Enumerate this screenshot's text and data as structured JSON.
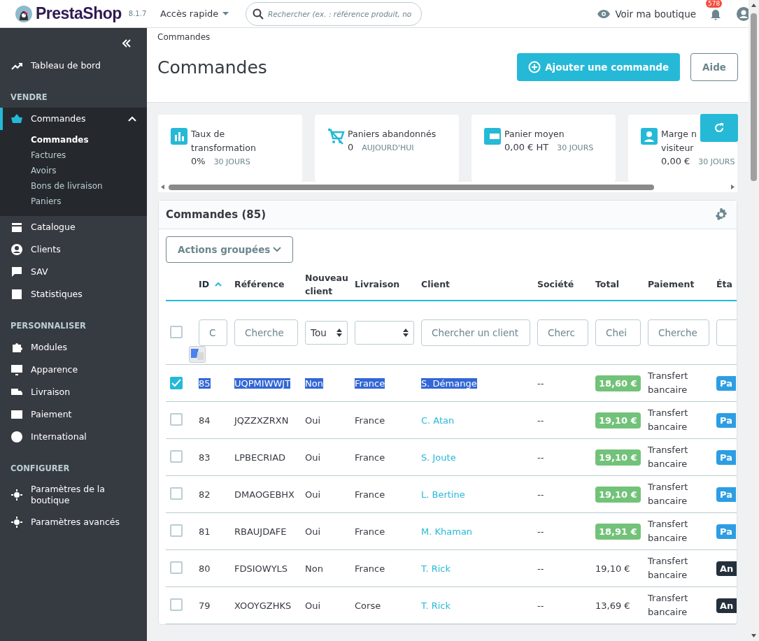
{
  "topbar": {
    "brand": "PrestaShop",
    "version": "8.1.7",
    "quick_access": "Accès rapide",
    "search": {
      "placeholder": "Rechercher (ex. : référence produit, no"
    },
    "view_shop": "Voir ma boutique",
    "notifications": "578"
  },
  "sidebar": {
    "sections": [
      {
        "items": [
          {
            "label": "Tableau de bord",
            "selected": false
          }
        ]
      },
      {
        "title": "VENDRE",
        "items": [
          {
            "label": "Commandes",
            "selected": true,
            "expanded": true,
            "children": [
              {
                "label": "Commandes",
                "selected": true
              },
              {
                "label": "Factures",
                "selected": false
              },
              {
                "label": "Avoirs",
                "selected": false
              },
              {
                "label": "Bons de livraison",
                "selected": false
              },
              {
                "label": "Paniers",
                "selected": false
              }
            ]
          },
          {
            "label": "Catalogue",
            "selected": false
          },
          {
            "label": "Clients",
            "selected": false
          },
          {
            "label": "SAV",
            "selected": false
          },
          {
            "label": "Statistiques",
            "selected": false
          }
        ]
      },
      {
        "title": "PERSONNALISER",
        "items": [
          {
            "label": "Modules",
            "selected": false
          },
          {
            "label": "Apparence",
            "selected": false
          },
          {
            "label": "Livraison",
            "selected": false
          },
          {
            "label": "Paiement",
            "selected": false
          },
          {
            "label": "International",
            "selected": false
          }
        ]
      },
      {
        "title": "CONFIGURER",
        "items": [
          {
            "label": "Paramètres de la boutique",
            "selected": false
          },
          {
            "label": "Paramètres avancés",
            "selected": false
          }
        ]
      }
    ]
  },
  "header": {
    "breadcrumb": "Commandes",
    "title": "Commandes",
    "buttons": [
      {
        "label": "Ajouter une commande",
        "kind": "primary"
      },
      {
        "label": "Aide",
        "kind": "outline"
      }
    ]
  },
  "kpis": [
    {
      "title": "Taux de\ntransformation",
      "value": "0%",
      "period": "30 JOURS"
    },
    {
      "title": "Paniers abandonnés",
      "value": "0",
      "period": "AUJOURD'HUI"
    },
    {
      "title": "Panier moyen",
      "value": "0,00 € HT",
      "period": "30 JOURS"
    },
    {
      "title": "Marge n\nvisiteur",
      "value": "0,00 €",
      "period": "30 JOURS"
    }
  ],
  "orders": {
    "title": "Commandes (85)",
    "bulk_actions": "Actions groupées",
    "columns": [
      {
        "label": "ID",
        "sorted": true
      },
      {
        "label": "Référence",
        "sorted": false
      },
      {
        "label": "Nouveau client",
        "sorted": false
      },
      {
        "label": "Livraison",
        "sorted": false
      },
      {
        "label": "Client",
        "sorted": false
      },
      {
        "label": "Société",
        "sorted": false
      },
      {
        "label": "Total",
        "sorted": false
      },
      {
        "label": "Paiement",
        "sorted": false
      },
      {
        "label": "Éta",
        "sorted": false
      }
    ],
    "select_all_checked": false,
    "filters": [
      {
        "kind": "input",
        "placeholder": "C"
      },
      {
        "kind": "input",
        "placeholder": "Cherche"
      },
      {
        "kind": "select",
        "value": "Tou"
      },
      {
        "kind": "select"
      },
      {
        "kind": "input",
        "placeholder": "Chercher un client"
      },
      {
        "kind": "input",
        "placeholder": "Cherc"
      },
      {
        "kind": "input",
        "placeholder": "Chei"
      },
      {
        "kind": "input",
        "placeholder": "Cherche"
      },
      {
        "kind": "input"
      }
    ],
    "rows": [
      {
        "checked": true,
        "highlighted": true,
        "id": "85",
        "reference": "UQPMIWWJT",
        "new_client": "Non",
        "delivery": "France",
        "client": "S. Démange",
        "company": "--",
        "total": "18,60 €",
        "total_badge": true,
        "payment": "Transfert bancaire",
        "state": "Pa",
        "color": "#2d9de4"
      },
      {
        "checked": false,
        "highlighted": false,
        "id": "84",
        "reference": "JQZZXZRXN",
        "new_client": "Oui",
        "delivery": "France",
        "client": "C. Atan",
        "company": "--",
        "total": "19,10 €",
        "total_badge": true,
        "payment": "Transfert bancaire",
        "state": "Pa",
        "color": "#2d9de4"
      },
      {
        "checked": false,
        "highlighted": false,
        "id": "83",
        "reference": "LPBECRIAD",
        "new_client": "Oui",
        "delivery": "France",
        "client": "S. Joute",
        "company": "--",
        "total": "19,10 €",
        "total_badge": true,
        "payment": "Transfert bancaire",
        "state": "Pa",
        "color": "#2d9de4"
      },
      {
        "checked": false,
        "highlighted": false,
        "id": "82",
        "reference": "DMAOGEBHX",
        "new_client": "Oui",
        "delivery": "France",
        "client": "L. Bertine",
        "company": "--",
        "total": "19,10 €",
        "total_badge": true,
        "payment": "Transfert bancaire",
        "state": "Pa",
        "color": "#2d9de4"
      },
      {
        "checked": false,
        "highlighted": false,
        "id": "81",
        "reference": "RBAUJDAFE",
        "new_client": "Oui",
        "delivery": "France",
        "client": "M. Khaman",
        "company": "--",
        "total": "18,91 €",
        "total_badge": true,
        "payment": "Transfert bancaire",
        "state": "Pa",
        "color": "#2d9de4"
      },
      {
        "checked": false,
        "highlighted": false,
        "id": "80",
        "reference": "FDSIOWYLS",
        "new_client": "Non",
        "delivery": "France",
        "client": "T. Rick",
        "company": "--",
        "total": "19,10 €",
        "total_badge": false,
        "payment": "Transfert bancaire",
        "state": "An",
        "color": "#25303d"
      },
      {
        "checked": false,
        "highlighted": false,
        "id": "79",
        "reference": "XOOYGZHKS",
        "new_client": "Oui",
        "delivery": "Corse",
        "client": "T. Rick",
        "company": "--",
        "total": "13,69 €",
        "total_badge": false,
        "payment": "Transfert bancaire",
        "state": "An",
        "color": "#25303d"
      }
    ]
  }
}
